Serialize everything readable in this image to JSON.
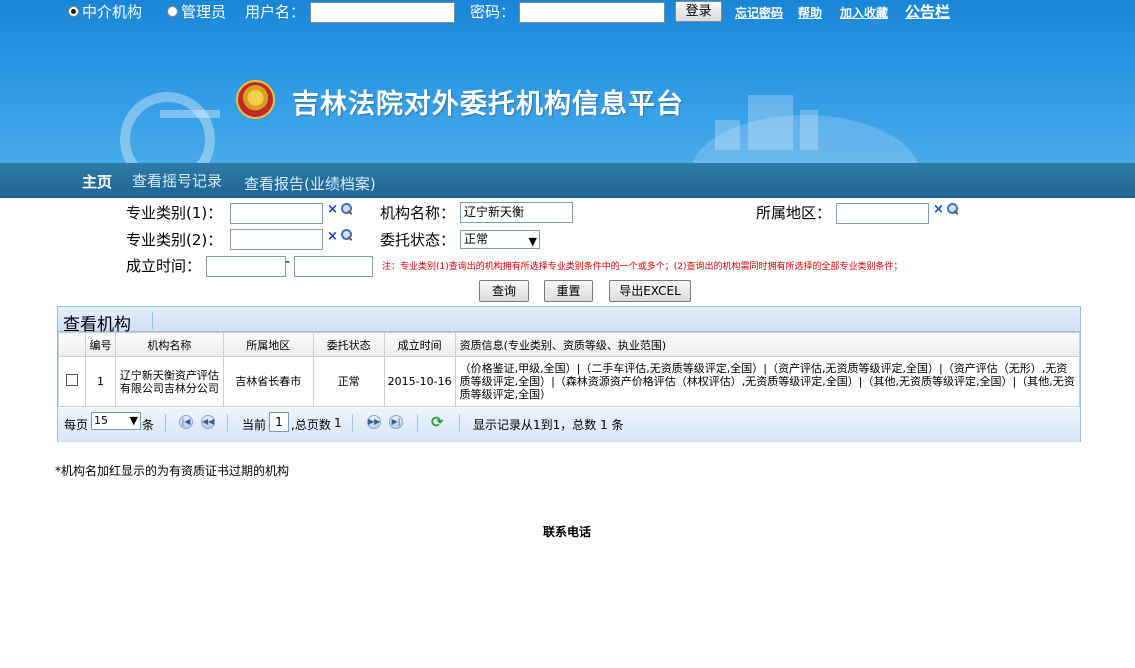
{
  "login": {
    "role_agency": "中介机构",
    "role_admin": "管理员",
    "username_label": "用户名：",
    "username_value": "",
    "password_label": "密码：",
    "password_value": "",
    "login_button": "登录",
    "forgot_password": "忘记密码",
    "help": "帮助",
    "add_favorite": "加入收藏",
    "bulletin": "公告栏"
  },
  "site": {
    "title": "吉林法院对外委托机构信息平台"
  },
  "nav": {
    "home": "主页",
    "lottery_records": "查看摇号记录",
    "reports": "查看报告(业绩档案)"
  },
  "search": {
    "category1_label": "专业类别(1)：",
    "category2_label": "专业类别(2)：",
    "org_name_label": "机构名称：",
    "org_name_value": "辽宁新天衡",
    "region_label": "所属地区：",
    "status_label": "委托状态：",
    "status_value": "正常",
    "established_label": "成立时间：",
    "clear_symbol": "×",
    "range_sep": "-",
    "note": "注：专业类别(1)查询出的机构拥有所选择专业类别条件中的一个或多个；(2)查询出的机构需同时拥有所选择的全部专业类别条件；",
    "query_button": "查询",
    "reset_button": "重置",
    "export_button": "导出EXCEL"
  },
  "grid": {
    "title": "查看机构",
    "columns": [
      "编号",
      "机构名称",
      "所属地区",
      "委托状态",
      "成立时间",
      "资质信息(专业类别、资质等级、执业范围)"
    ],
    "rows": [
      {
        "no": "1",
        "name": "辽宁新天衡资产评估有限公司吉林分公司",
        "region": "吉林省长春市",
        "status": "正常",
        "established": "2015-10-16",
        "qualifications": "（价格鉴证,甲级,全国）|（二手车评估,无资质等级评定,全国）|（资产评估,无资质等级评定,全国）|（资产评估（无形）,无资质等级评定,全国）|（森林资源资产价格评估（林权评估）,无资质等级评定,全国）|（其他,无资质等级评定,全国）|（其他,无资质等级评定,全国）"
      }
    ]
  },
  "pager": {
    "per_page_label": "每页",
    "per_page_value": "15",
    "per_page_unit": "条",
    "current_label": "当前",
    "current_page": "1",
    "total_pages_label": ",总页数",
    "total_pages": "1",
    "summary": "显示记录从1到1，总数 1 条"
  },
  "footer": {
    "footnote": "*机构名加红显示的为有资质证书过期的机构",
    "contact": "联系电话"
  },
  "colors": {
    "banner_blue": "#2b97e4",
    "nav_bar": "#1e6593",
    "panel_border": "#99bbe8",
    "note_red": "#e00000"
  }
}
